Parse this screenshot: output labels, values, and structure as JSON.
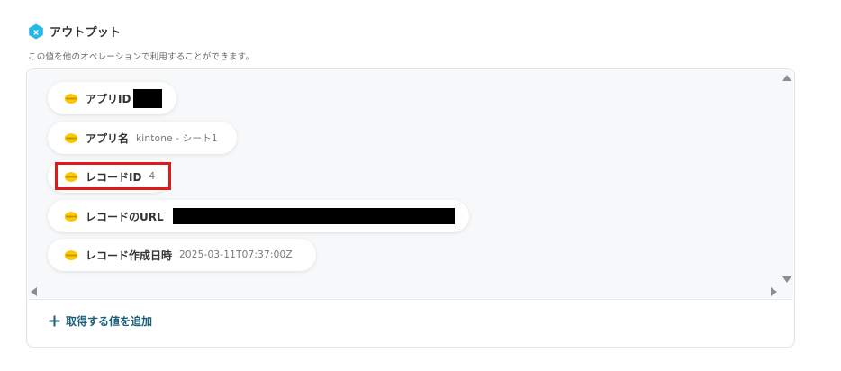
{
  "output_section": {
    "title": "アウトプット",
    "description": "この値を他のオペレーションで利用することができます。",
    "icon": "x-variable-icon"
  },
  "output_items": [
    {
      "label": "アプリID",
      "value": "",
      "redacted": true,
      "icon": "kintone-icon"
    },
    {
      "label": "アプリ名",
      "value": "kintone - シート1",
      "redacted": false,
      "icon": "kintone-icon"
    },
    {
      "label": "レコードID",
      "value": "4",
      "redacted": false,
      "highlighted": true,
      "icon": "kintone-icon"
    },
    {
      "label": "レコードのURL",
      "value": "",
      "redacted": true,
      "icon": "kintone-icon"
    },
    {
      "label": "レコード作成日時",
      "value": "2025-03-11T07:37:00Z",
      "redacted": false,
      "icon": "kintone-icon"
    }
  ],
  "add_button": {
    "label": "取得する値を追加",
    "icon": "plus-icon"
  },
  "colors": {
    "accent_teal": "#1b5e7a",
    "icon_cyan": "#29b6e8",
    "kintone_yellow": "#fcc800",
    "highlight_red": "#e0191b"
  }
}
